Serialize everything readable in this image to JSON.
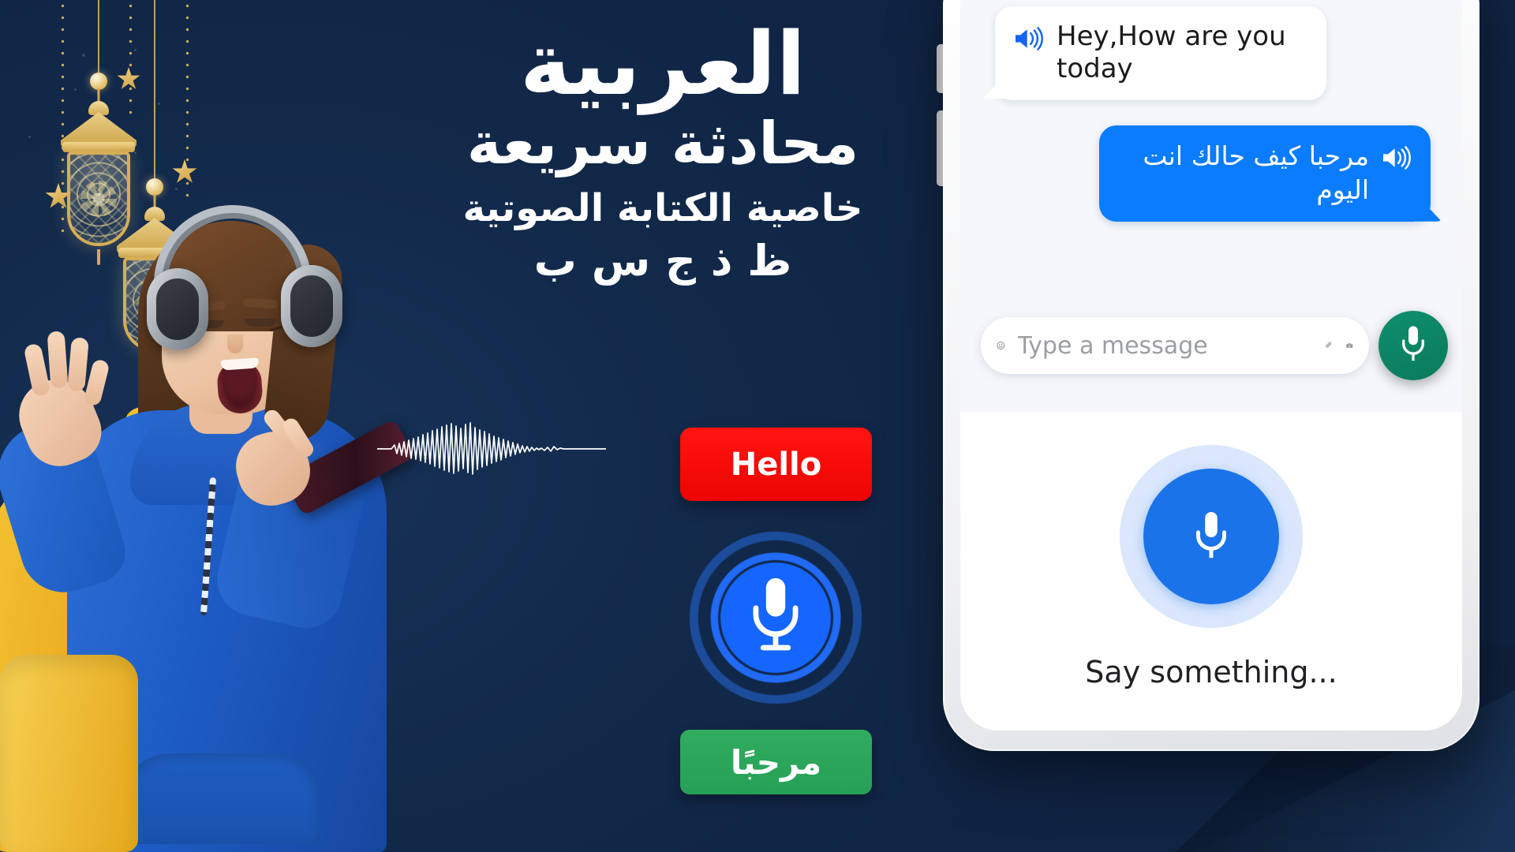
{
  "theme": {
    "background_navy": "#12294a",
    "accent_blue": "#1566ff",
    "chat_blue": "#0a7cff",
    "hello_red": "#ff1411",
    "marhaba_green": "#2aa357",
    "mic_fab_green": "#0c8568",
    "gold": "#d6ae55",
    "listen_blue": "#1a73e8"
  },
  "headline": {
    "line1": "العربية",
    "line2": "محادثة سريعة",
    "line3": "خاصية الكتابة الصوتية",
    "decorative_letters": "ظ ذ ج س ب"
  },
  "decorations": {
    "lantern_icon": "lantern-icon",
    "star_icon": "star-icon",
    "waveform_icon": "audio-waveform-icon",
    "lantern_count": 2,
    "star_count": 3
  },
  "buttons": {
    "hello": "Hello",
    "marhaba": "مرحبًا",
    "mic_icon": "microphone-icon"
  },
  "phone": {
    "chat": {
      "incoming": {
        "text": "Hey,How are you today",
        "speaker_icon": "speaker-icon"
      },
      "outgoing": {
        "text": "مرحبا كيف حالك انت اليوم",
        "speaker_icon": "speaker-icon"
      }
    },
    "input_bar": {
      "placeholder": "Type a message",
      "value": "",
      "emoji_icon": "emoji-smiley-icon",
      "attach_icon": "paperclip-icon",
      "camera_icon": "camera-icon"
    },
    "fab": {
      "icon": "microphone-icon"
    },
    "listening": {
      "label": "Say something...",
      "mic_icon": "microphone-icon"
    }
  }
}
